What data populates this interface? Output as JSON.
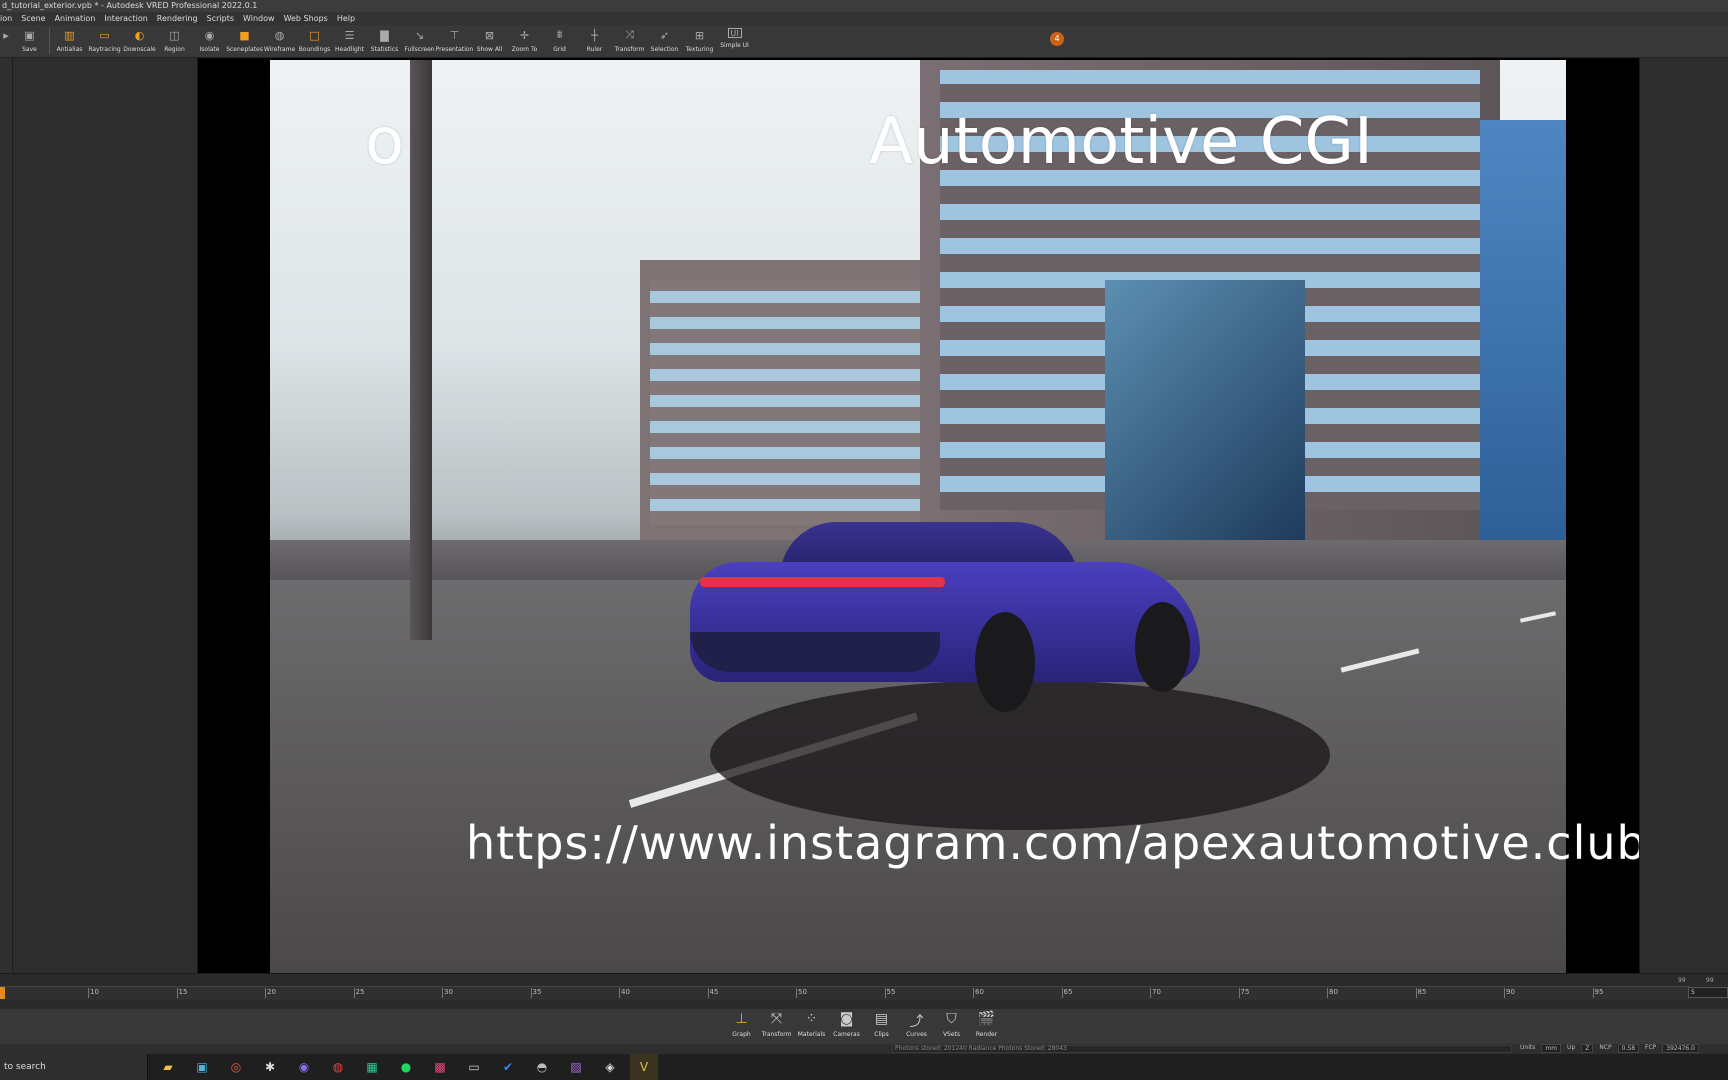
{
  "window": {
    "title": "d_tutorial_exterior.vpb * - Autodesk VRED Professional 2022.0.1"
  },
  "menu": [
    "ion",
    "Scene",
    "Animation",
    "Interaction",
    "Rendering",
    "Scripts",
    "Window",
    "Web Shops",
    "Help"
  ],
  "toolbar": [
    {
      "label": "Save",
      "icon": "floppy-icon"
    },
    {
      "label": "Antialias",
      "icon": "antialias-icon"
    },
    {
      "label": "Raytracing",
      "icon": "raytracing-icon"
    },
    {
      "label": "Downscale",
      "icon": "downscale-icon"
    },
    {
      "label": "Region",
      "icon": "region-icon"
    },
    {
      "label": "Isolate",
      "icon": "isolate-icon"
    },
    {
      "label": "Sceneplates",
      "icon": "sceneplates-icon"
    },
    {
      "label": "Wireframe",
      "icon": "wireframe-icon"
    },
    {
      "label": "Boundings",
      "icon": "boundings-icon"
    },
    {
      "label": "Headlight",
      "icon": "headlight-icon"
    },
    {
      "label": "Statistics",
      "icon": "statistics-icon"
    },
    {
      "label": "Fullscreen",
      "icon": "fullscreen-icon"
    },
    {
      "label": "Presentation",
      "icon": "presentation-icon"
    },
    {
      "label": "Show All",
      "icon": "show-all-icon"
    },
    {
      "label": "Zoom To",
      "icon": "zoom-to-icon"
    },
    {
      "label": "Grid",
      "icon": "grid-icon"
    },
    {
      "label": "Ruler",
      "icon": "ruler-icon"
    },
    {
      "label": "Transform",
      "icon": "transform-icon"
    },
    {
      "label": "Selection",
      "icon": "selection-icon"
    },
    {
      "label": "Texturing",
      "icon": "texturing-icon"
    },
    {
      "label": "Simple UI",
      "icon": "simple-ui-icon"
    }
  ],
  "notification_count": "4",
  "overlay": {
    "title_left": "o",
    "title_right": "Automotive CGI",
    "url": "https://www.instagram.com/apexautomotive.club/"
  },
  "timeline": {
    "ticks": [
      "10",
      "15",
      "20",
      "25",
      "30",
      "35",
      "40",
      "45",
      "50",
      "55",
      "60",
      "65",
      "70",
      "75",
      "80",
      "85",
      "90",
      "95"
    ],
    "end_a": "99",
    "end_b": "99",
    "current": "5"
  },
  "bottom_tools": [
    {
      "label": "Graph",
      "icon": "graph-icon"
    },
    {
      "label": "Transform",
      "icon": "transform-icon"
    },
    {
      "label": "Materials",
      "icon": "materials-icon"
    },
    {
      "label": "Cameras",
      "icon": "cameras-icon"
    },
    {
      "label": "Clips",
      "icon": "clips-icon"
    },
    {
      "label": "Curves",
      "icon": "curves-icon"
    },
    {
      "label": "VSets",
      "icon": "vsets-icon"
    },
    {
      "label": "Render",
      "icon": "render-icon"
    }
  ],
  "status": {
    "message": "Photons stored: 201240  Radiance Photons Stored: 28043",
    "units_label": "Units",
    "units_value": "mm",
    "up_label": "Up",
    "up_value": "Z",
    "ncp_label": "NCP",
    "ncp_value": "0.58",
    "fcp_label": "FCP",
    "fcp_value": "392476.0"
  },
  "taskbar": {
    "search_placeholder": "to search"
  }
}
